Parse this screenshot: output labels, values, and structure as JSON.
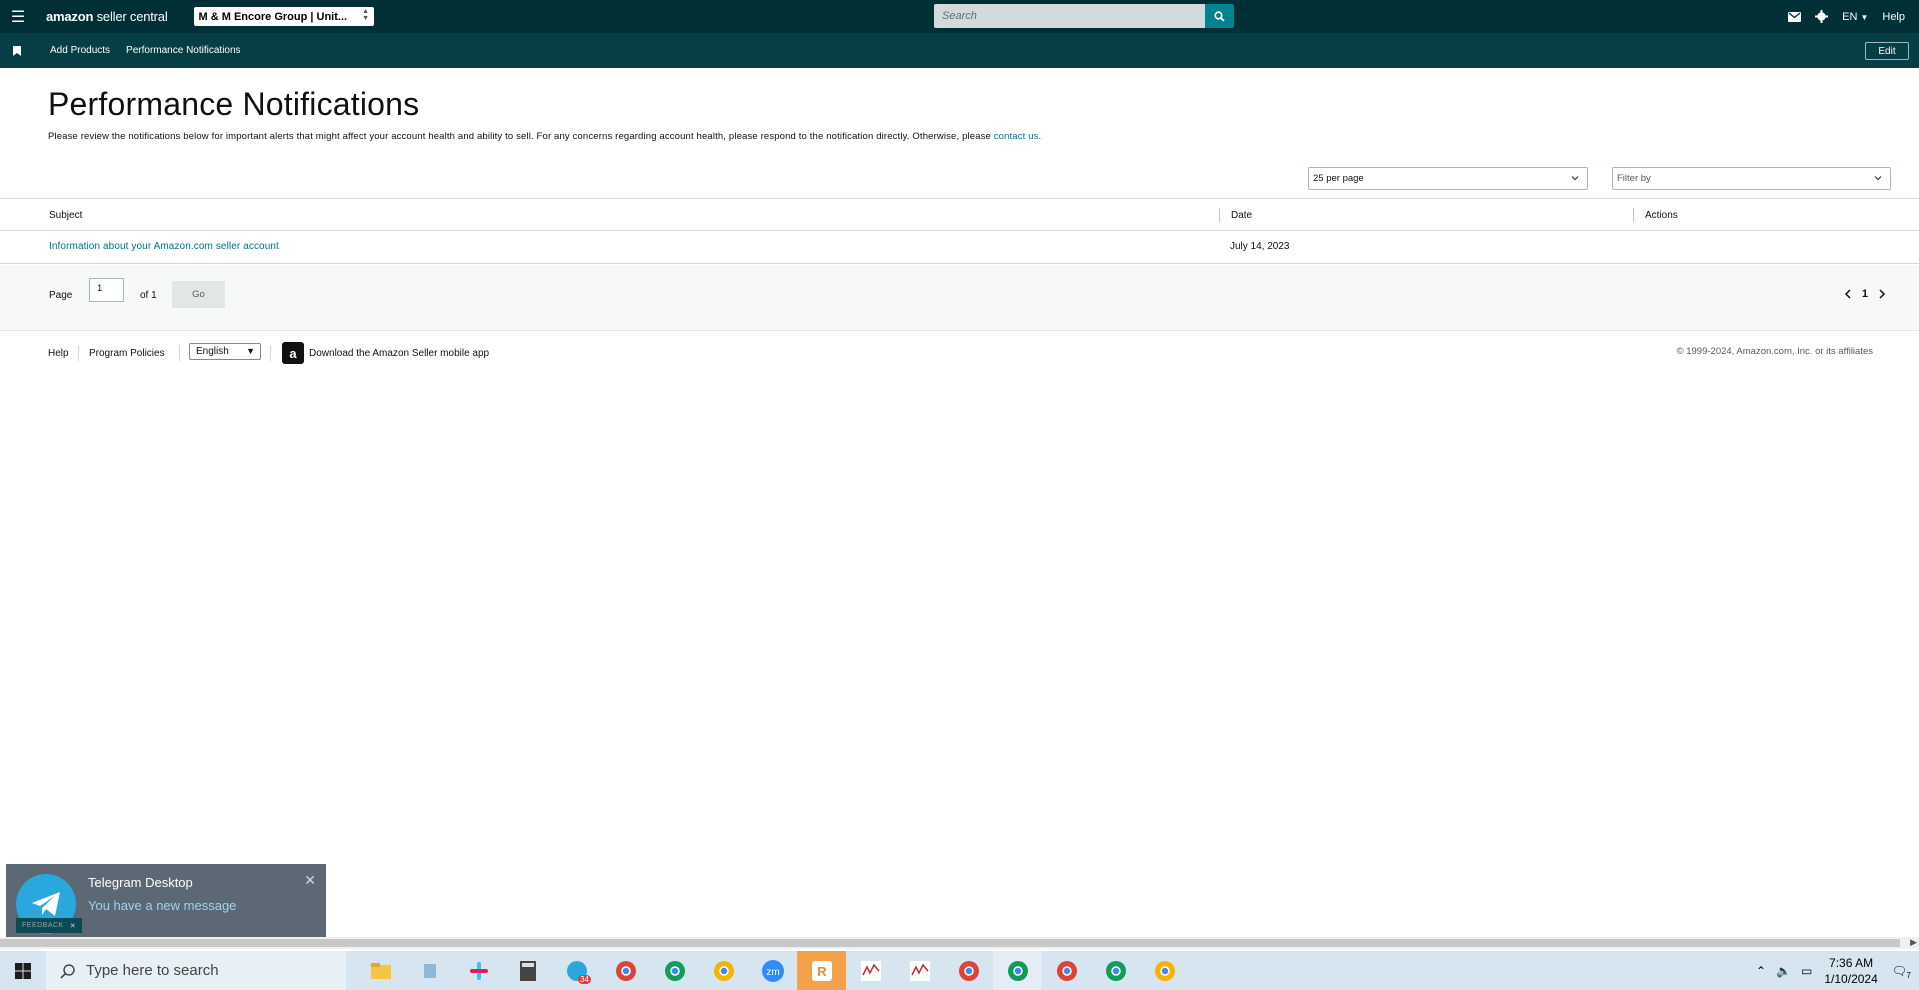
{
  "header": {
    "logo_brand": "amazon",
    "logo_suffix": "seller central",
    "account_selector": "M & M Encore Group | Unit...",
    "search_placeholder": "Search",
    "language": "EN",
    "help": "Help"
  },
  "subnav": {
    "items": [
      "Add Products",
      "Performance Notifications"
    ],
    "edit_label": "Edit"
  },
  "page": {
    "title": "Performance Notifications",
    "intro_text": "Please review the notifications below for important alerts that might affect your account health and ability to sell. For any concerns regarding account health, please respond to the notification directly. Otherwise, please ",
    "intro_link": "contact us.",
    "per_page": "25 per page",
    "filter_placeholder": "Filter by"
  },
  "table": {
    "headers": [
      "Subject",
      "Date",
      "Actions"
    ],
    "rows": [
      {
        "subject": "Information about your Amazon.com seller account",
        "date": "July 14, 2023",
        "actions": ""
      }
    ]
  },
  "pagination": {
    "page_label": "Page",
    "current": "1",
    "of_label": "of 1",
    "go_label": "Go",
    "nav_current": "1"
  },
  "footer": {
    "help": "Help",
    "policies": "Program Policies",
    "language": "English",
    "app_link": "Download the Amazon Seller mobile app",
    "copyright": "© 1999-2024, Amazon.com, Inc. or its affiliates"
  },
  "toast": {
    "title": "Telegram Desktop",
    "message": "You have a new message"
  },
  "feedback_label": "FEEDBACK",
  "taskbar": {
    "search_placeholder": "Type here to search",
    "time": "7:36 AM",
    "date": "1/10/2024",
    "telegram_badge": "34",
    "notification_count": "7"
  },
  "colors": {
    "topbar": "#002f36",
    "subbar": "#073d44",
    "link": "#007185",
    "search_button": "#00838f"
  }
}
